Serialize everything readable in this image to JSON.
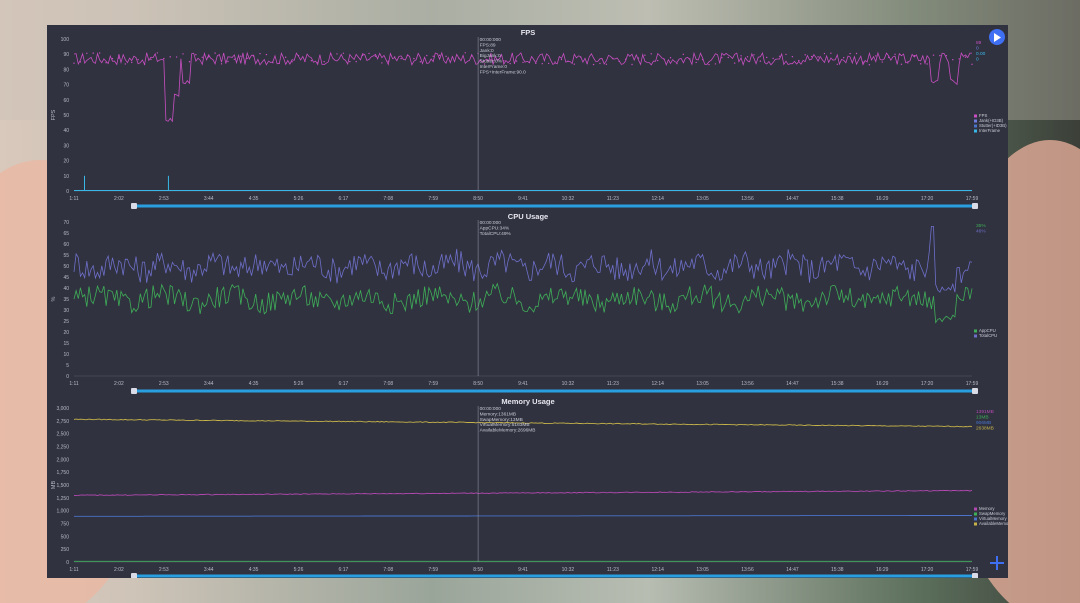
{
  "colors": {
    "fps": "#c74fc2",
    "jank": "#6f7ce0",
    "cyan": "#39b7e8",
    "app": "#3fae58",
    "total": "#6e6fc9",
    "memory": "#b248b0",
    "swap": "#3fae58",
    "virtual": "#4a73c9",
    "available": "#c6b34a"
  },
  "icons": {
    "play": "play-icon",
    "add": "plus-icon"
  },
  "x_ticks": [
    "1:11",
    "2:02",
    "2:53",
    "3:44",
    "4:35",
    "5:26",
    "6:17",
    "7:08",
    "7:59",
    "8:50",
    "9:41",
    "10:32",
    "11:23",
    "12:14",
    "13:05",
    "13:56",
    "14:47",
    "15:38",
    "16:29",
    "17:20",
    "17:59"
  ],
  "chart_data": [
    {
      "type": "line",
      "title": "FPS",
      "ylabel": "FPS",
      "ylim": [
        0,
        100
      ],
      "y_ticks": [
        "0",
        "10",
        "20",
        "30",
        "40",
        "50",
        "60",
        "70",
        "80",
        "90",
        "100"
      ],
      "cursor": {
        "x": "8:50",
        "lines": [
          "00:00:000",
          "FPS:89",
          "Jank:0",
          "BigJank:0",
          "Stutter:0%",
          "InterFrame:0",
          "FPS+InterFrame:90.0"
        ]
      },
      "right_values": [
        "89",
        "0",
        "0.00",
        "0"
      ],
      "legend": [
        "FPS",
        "Jank(+ID3B)",
        "Stutter(+ID3B)",
        "InterFrame"
      ],
      "series": [
        {
          "name": "FPS",
          "baseline": 87,
          "noise": 4,
          "dips": [
            [
              2.95,
              45
            ],
            [
              3.1,
              60
            ],
            [
              3.3,
              70
            ],
            [
              17.3,
              71
            ],
            [
              17.66,
              70
            ]
          ]
        },
        {
          "name": "InterFrame",
          "spikes": [
            [
              1.38,
              10
            ],
            [
              2.95,
              10
            ]
          ]
        }
      ]
    },
    {
      "type": "line",
      "title": "CPU Usage",
      "ylabel": "%",
      "ylim": [
        0,
        70
      ],
      "y_ticks": [
        "0",
        "5",
        "10",
        "15",
        "20",
        "25",
        "30",
        "35",
        "40",
        "45",
        "50",
        "55",
        "60",
        "65",
        "70"
      ],
      "cursor": {
        "x": "8:50",
        "lines": [
          "00:00:000",
          "AppCPU:34%",
          "TotalCPU:49%"
        ]
      },
      "right_values": [
        "35%",
        "46%"
      ],
      "legend": [
        "AppCPU",
        "TotalCPU"
      ],
      "series": [
        {
          "name": "AppCPU",
          "baseline": 35,
          "noise": 5
        },
        {
          "name": "TotalCPU",
          "baseline": 50,
          "noise": 6
        }
      ]
    },
    {
      "type": "line",
      "title": "Memory Usage",
      "ylabel": "MB",
      "ylim": [
        0,
        3000
      ],
      "y_ticks": [
        "0",
        "250",
        "500",
        "750",
        "1,000",
        "1,250",
        "1,500",
        "1,750",
        "2,000",
        "2,250",
        "2,500",
        "2,750",
        "3,000"
      ],
      "cursor": {
        "x": "8:50",
        "lines": [
          "00:00:000",
          "Memory:1361MB",
          "SwapMemory:13MB",
          "VirtualMemory:5163MB",
          "AvailableMemory:2696MB"
        ]
      },
      "right_values": [
        "1391MB",
        "13MB",
        "906MB",
        "2638MB"
      ],
      "legend": [
        "Memory",
        "SwapMemory",
        "VirtualMemory",
        "AvailableMemo..."
      ],
      "series": [
        {
          "name": "Memory",
          "start": 1300,
          "end": 1391
        },
        {
          "name": "SwapMemory",
          "value": 13
        },
        {
          "name": "VirtualMemory",
          "start": 890,
          "end": 906
        },
        {
          "name": "AvailableMemory",
          "start": 2780,
          "end": 2638
        }
      ]
    }
  ]
}
